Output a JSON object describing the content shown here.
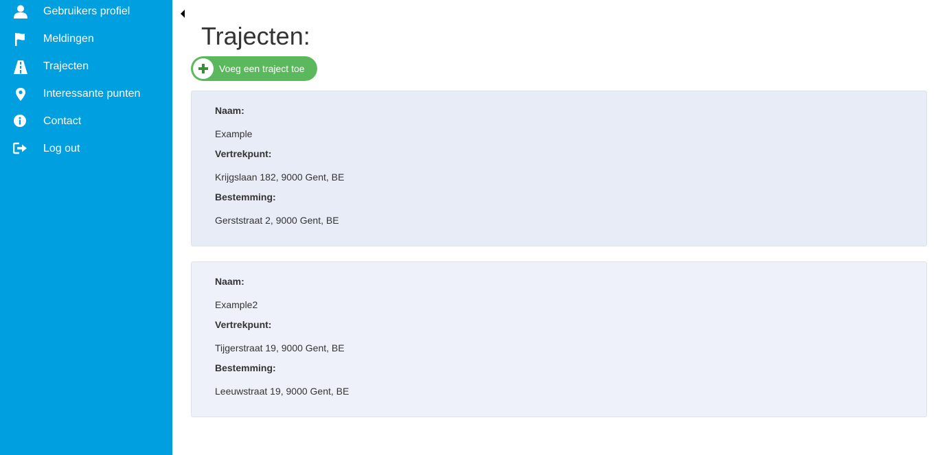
{
  "sidebar": {
    "background": "#009fe0",
    "items": [
      {
        "label": "Gebruikers profiel",
        "icon": "user-icon"
      },
      {
        "label": "Meldingen",
        "icon": "flag-icon"
      },
      {
        "label": "Trajecten",
        "icon": "road-icon"
      },
      {
        "label": "Interessante punten",
        "icon": "map-marker-icon"
      },
      {
        "label": "Contact",
        "icon": "info-circle-icon"
      },
      {
        "label": "Log out",
        "icon": "sign-out-icon"
      }
    ]
  },
  "main": {
    "title": "Trajecten:",
    "add_button": {
      "label": "Voeg een traject toe",
      "icon": "plus-circle-icon",
      "color": "#5cb85c"
    },
    "field_labels": {
      "name": "Naam:",
      "start": "Vertrekpunt:",
      "destination": "Bestemming:"
    },
    "routes": [
      {
        "name": "Example",
        "start": "Krijgslaan 182, 9000 Gent, BE",
        "destination": "Gerststraat 2, 9000 Gent, BE"
      },
      {
        "name": "Example2",
        "start": "Tijgerstraat 19, 9000 Gent, BE",
        "destination": "Leeuwstraat 19, 9000 Gent, BE"
      }
    ]
  }
}
